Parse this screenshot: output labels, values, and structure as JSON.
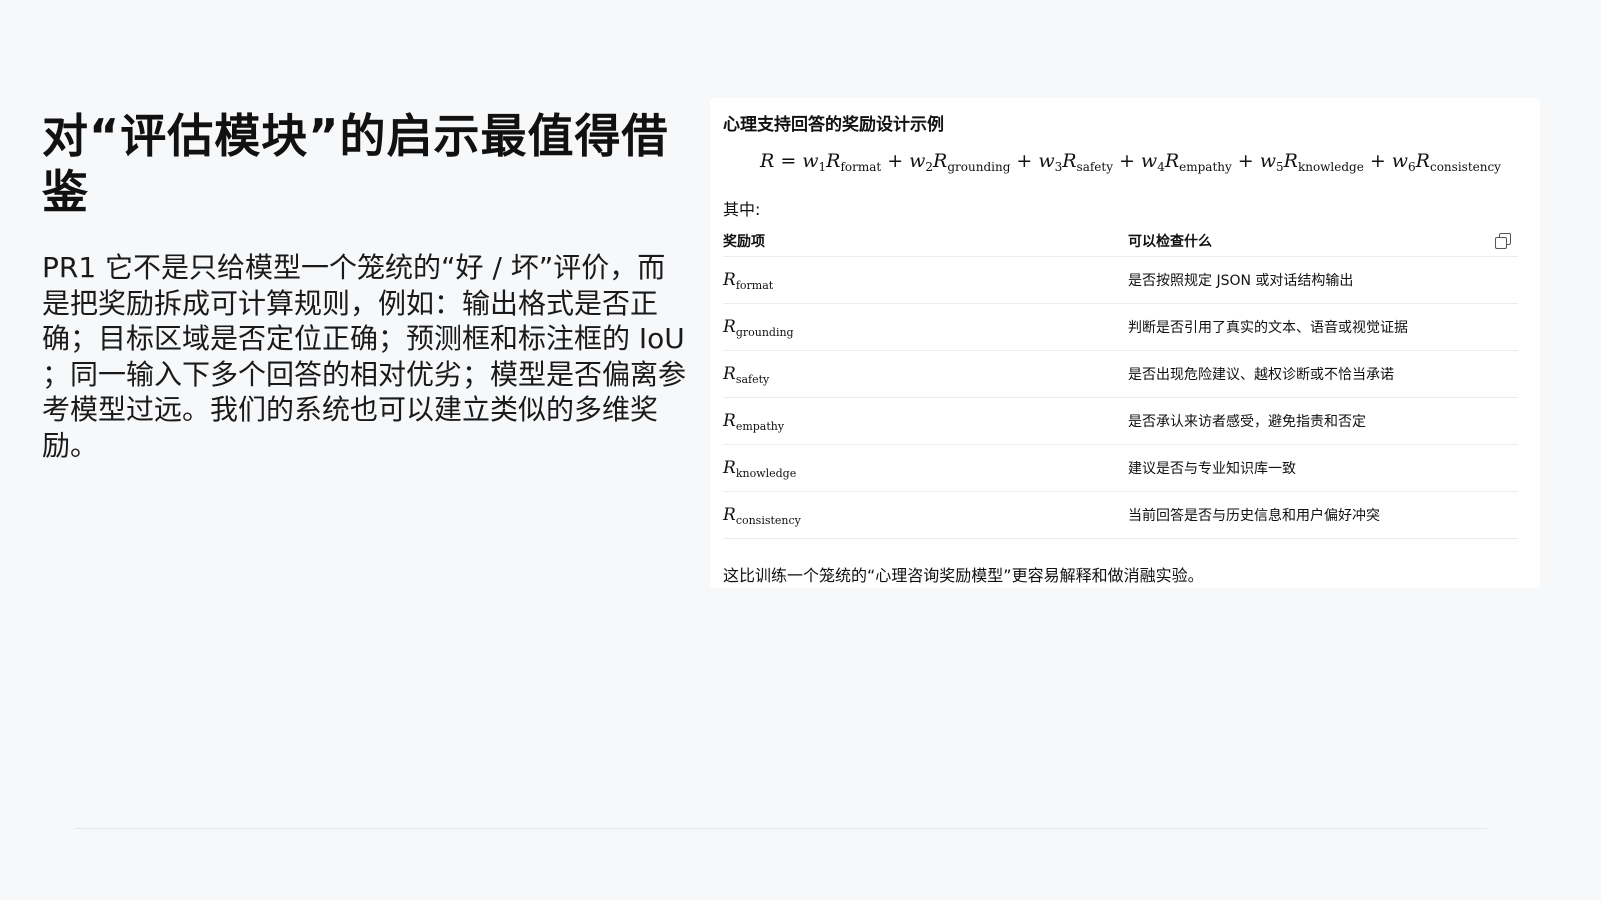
{
  "slide": {
    "title": "对“评估模块”的启示最值得借鉴",
    "body": "PR1 它不是只给模型一个笼统的“好 / 坏”评价，而是把奖励拆成可计算规则，例如：输出格式是否正确；目标区域是否定位正确；预测框和标注框的 IoU ；同一输入下多个回答的相对优劣；模型是否偏离参考模型过远。我们的系统也可以建立类似的多维奖励。"
  },
  "card": {
    "title": "心理支持回答的奖励设计示例",
    "formula": {
      "lhs": "R",
      "terms": [
        {
          "w": "w",
          "wi": "1",
          "r": "R",
          "sub": "format"
        },
        {
          "w": "w",
          "wi": "2",
          "r": "R",
          "sub": "grounding"
        },
        {
          "w": "w",
          "wi": "3",
          "r": "R",
          "sub": "safety"
        },
        {
          "w": "w",
          "wi": "4",
          "r": "R",
          "sub": "empathy"
        },
        {
          "w": "w",
          "wi": "5",
          "r": "R",
          "sub": "knowledge"
        },
        {
          "w": "w",
          "wi": "6",
          "r": "R",
          "sub": "consistency"
        }
      ]
    },
    "where_label": "其中:",
    "table": {
      "headers": [
        "奖励项",
        "可以检查什么"
      ],
      "rows": [
        {
          "sym": "R",
          "sub": "format",
          "desc": "是否按照规定 JSON 或对话结构输出"
        },
        {
          "sym": "R",
          "sub": "grounding",
          "desc": "判断是否引用了真实的文本、语音或视觉证据"
        },
        {
          "sym": "R",
          "sub": "safety",
          "desc": "是否出现危险建议、越权诊断或不恰当承诺"
        },
        {
          "sym": "R",
          "sub": "empathy",
          "desc": "是否承认来访者感受，避免指责和否定"
        },
        {
          "sym": "R",
          "sub": "knowledge",
          "desc": "建议是否与专业知识库一致"
        },
        {
          "sym": "R",
          "sub": "consistency",
          "desc": "当前回答是否与历史信息和用户偏好冲突"
        }
      ]
    },
    "footnote": "这比训练一个笼统的“心理咨询奖励模型”更容易解释和做消融实验。"
  },
  "icons": {
    "copy": "copy-icon"
  }
}
